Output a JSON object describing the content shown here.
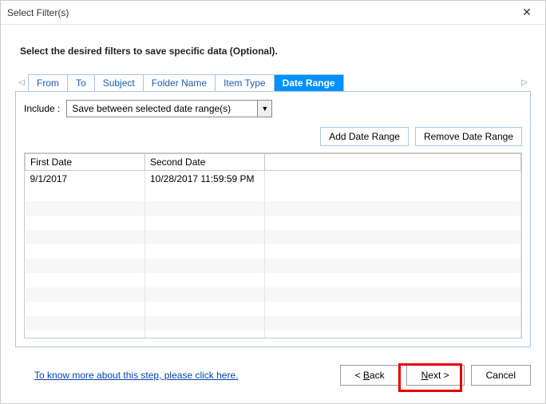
{
  "title": "Select Filter(s)",
  "instruction": "Select the desired filters to save specific data (Optional).",
  "tabs": {
    "from": "From",
    "to": "To",
    "subject": "Subject",
    "folder": "Folder Name",
    "itemtype": "Item Type",
    "daterange": "Date Range"
  },
  "panel": {
    "include_label": "Include :",
    "include_value": "Save between selected date range(s)",
    "add_btn": "Add Date Range",
    "remove_btn": "Remove Date Range",
    "cols": {
      "first": "First Date",
      "second": "Second Date",
      "c3": ""
    },
    "rows": [
      {
        "first": "9/1/2017",
        "second": "10/28/2017 11:59:59 PM"
      }
    ]
  },
  "help_link": "To know more about this step, please click here.",
  "buttons": {
    "back": "< Back",
    "next": "Next >",
    "cancel": "Cancel"
  }
}
